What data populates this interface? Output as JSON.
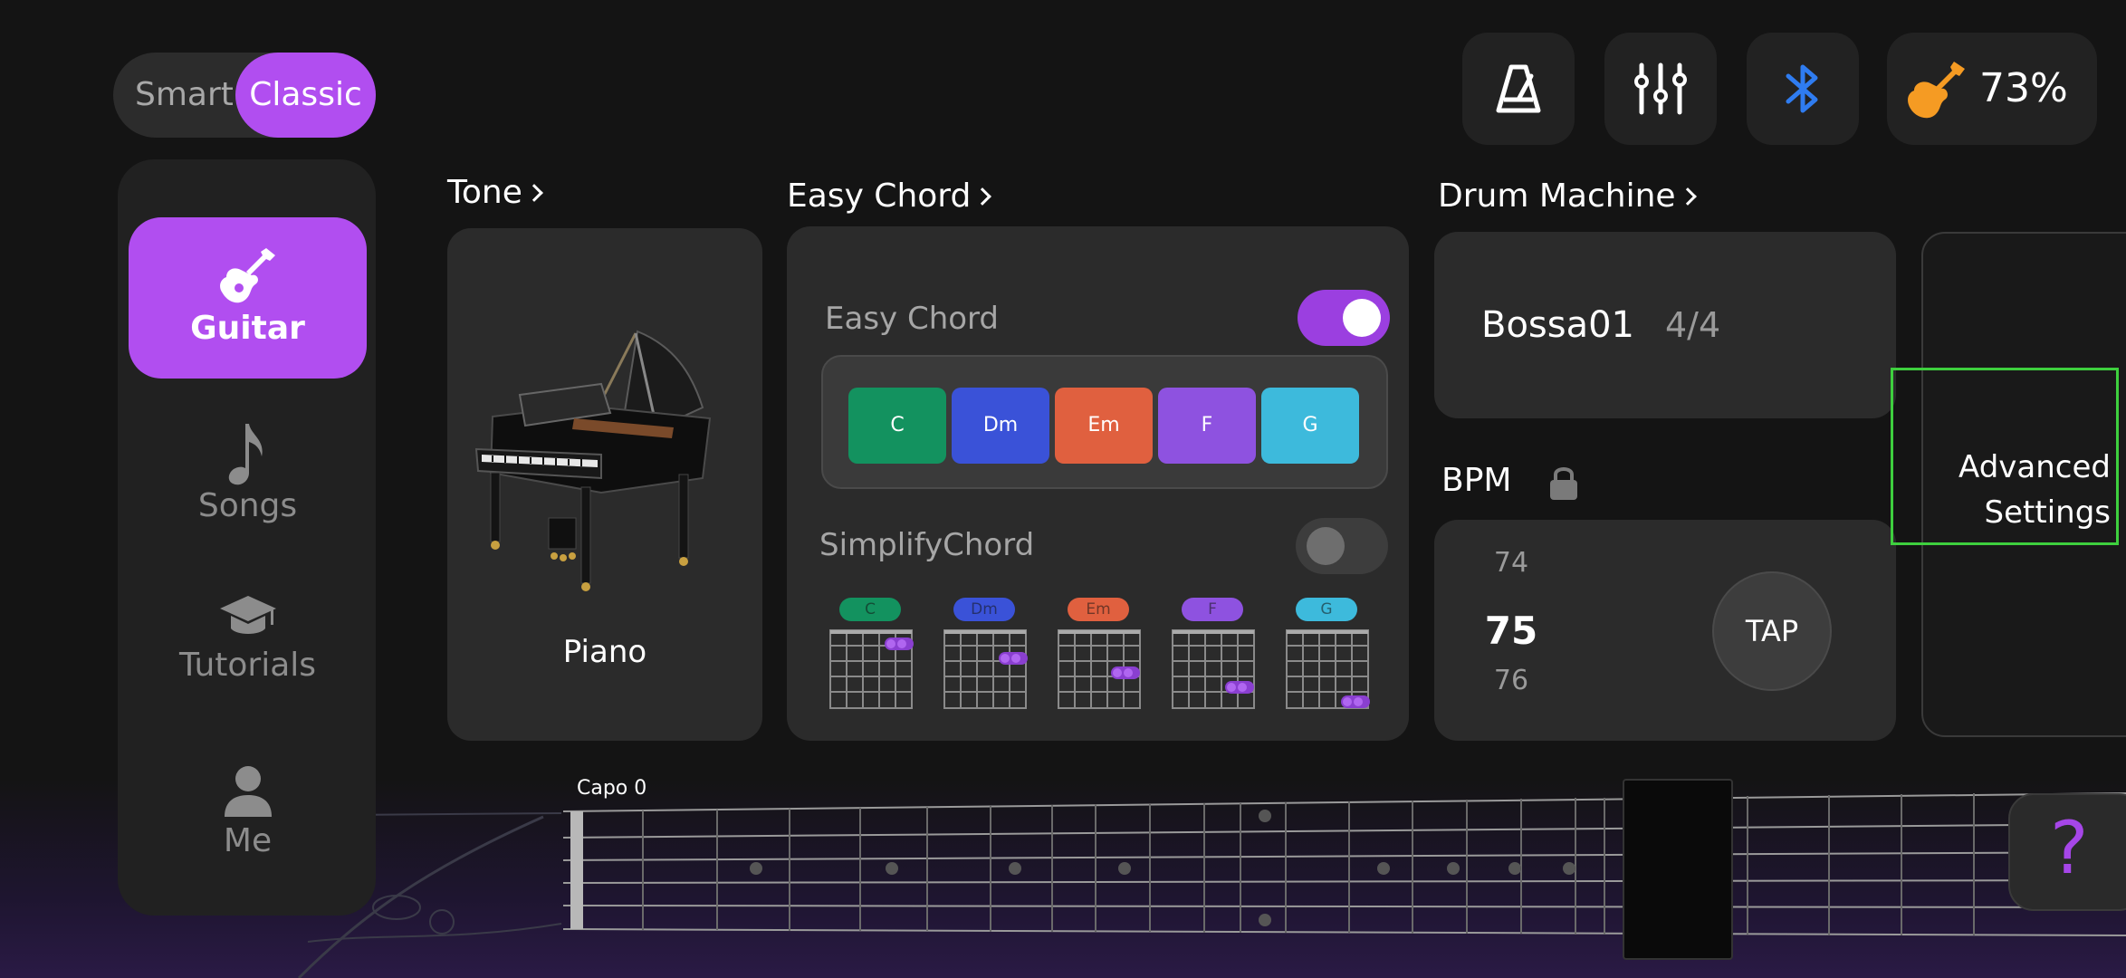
{
  "mode_toggle": {
    "smart_label": "Smart",
    "classic_label": "Classic",
    "selected": "Classic"
  },
  "nav": {
    "items": [
      {
        "label": "Guitar",
        "icon": "guitar-icon",
        "active": true
      },
      {
        "label": "Songs",
        "icon": "music-note-icon",
        "active": false
      },
      {
        "label": "Tutorials",
        "icon": "graduation-cap-icon",
        "active": false
      },
      {
        "label": "Me",
        "icon": "user-icon",
        "active": false
      }
    ]
  },
  "top_bar": {
    "icons": [
      "metronome-icon",
      "mixer-sliders-icon",
      "bluetooth-icon"
    ],
    "battery_percent": "73%",
    "battery_icon": "guitar-battery-icon"
  },
  "tone": {
    "title": "Tone",
    "instrument": "Piano"
  },
  "easy_chord": {
    "title": "Easy Chord",
    "toggle_label": "Easy Chord",
    "toggle_on": true,
    "chords": [
      {
        "name": "C",
        "color": "#13925f"
      },
      {
        "name": "Dm",
        "color": "#3a52d8"
      },
      {
        "name": "Em",
        "color": "#e0603f"
      },
      {
        "name": "F",
        "color": "#8e52e0"
      },
      {
        "name": "G",
        "color": "#3dbadc"
      }
    ],
    "simplify_label": "SimplifyChord",
    "simplify_on": false
  },
  "drum": {
    "title": "Drum Machine",
    "pattern": "Bossa01",
    "time_signature": "4/4",
    "bpm_label": "BPM",
    "bpm_prev": "74",
    "bpm_current": "75",
    "bpm_next": "76",
    "tap_label": "TAP"
  },
  "advanced": {
    "line1": "Advanced",
    "line2": "Settings"
  },
  "fretboard": {
    "capo_label": "Capo 0"
  },
  "help": {
    "label": "?"
  }
}
